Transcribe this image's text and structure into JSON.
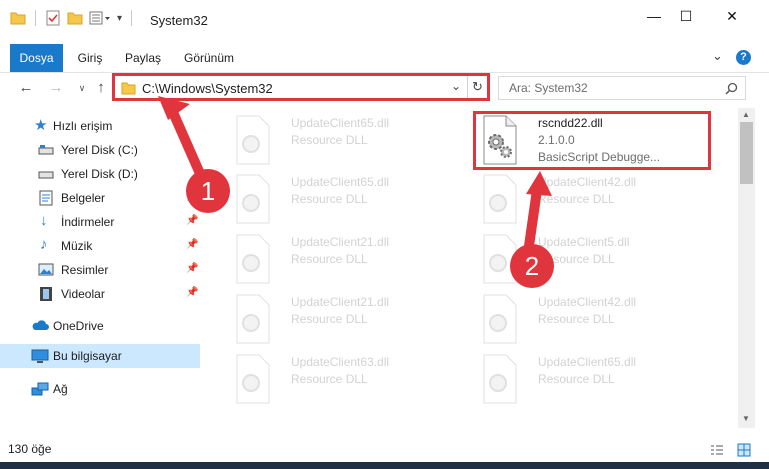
{
  "window": {
    "title": "System32",
    "controls": {
      "minimize": "—",
      "maximize": "☐",
      "close": "✕"
    }
  },
  "ribbon": {
    "tabs": [
      "Dosya",
      "Giriş",
      "Paylaş",
      "Görünüm"
    ],
    "active_tab": "Dosya",
    "help_icon": "?",
    "expand_icon": "⌄"
  },
  "address": {
    "path": "C:\\Windows\\System32",
    "search_placeholder": "Ara: System32"
  },
  "nav": {
    "items": [
      {
        "label": "Hızlı erişim",
        "icon": "star-icon"
      },
      {
        "label": "Yerel Disk (C:)",
        "icon": "drive-icon"
      },
      {
        "label": "Yerel Disk (D:)",
        "icon": "drive-icon"
      },
      {
        "label": "Belgeler",
        "icon": "documents-icon"
      },
      {
        "label": "İndirmeler",
        "icon": "download-icon"
      },
      {
        "label": "Müzik",
        "icon": "music-icon"
      },
      {
        "label": "Resimler",
        "icon": "pictures-icon"
      },
      {
        "label": "Videolar",
        "icon": "video-icon"
      },
      {
        "label": "OneDrive",
        "icon": "cloud-icon"
      },
      {
        "label": "Bu bilgisayar",
        "icon": "computer-icon"
      },
      {
        "label": "Ağ",
        "icon": "network-icon"
      }
    ],
    "pinned": [
      3,
      4,
      5,
      6,
      7
    ]
  },
  "files": [
    {
      "name": "UpdateClient65.dll",
      "sub": "Resource DLL"
    },
    {
      "name": "rscndd22.dll",
      "version": "2.1.0.0",
      "sub": "BasicScript Debugge..."
    },
    {
      "name": "UpdateClient65.dll",
      "sub": "Resource DLL"
    },
    {
      "name": "UpdateClient42.dll",
      "sub": "Resource DLL"
    },
    {
      "name": "UpdateClient21.dll",
      "sub": "Resource DLL"
    },
    {
      "name": "UpdateClient5.dll",
      "sub": "Resource DLL"
    },
    {
      "name": "UpdateClient21.dll",
      "sub": "Resource DLL"
    },
    {
      "name": "UpdateClient42.dll",
      "sub": "Resource DLL"
    },
    {
      "name": "UpdateClient63.dll",
      "sub": "Resource DLL"
    },
    {
      "name": "UpdateClient65.dll",
      "sub": "Resource DLL"
    }
  ],
  "status": {
    "count": "130 öğe"
  },
  "annotations": {
    "step1": "1",
    "step2": "2"
  },
  "colors": {
    "accent": "#1979ca",
    "highlight": "#e0353c",
    "selected": "#cce8ff"
  }
}
